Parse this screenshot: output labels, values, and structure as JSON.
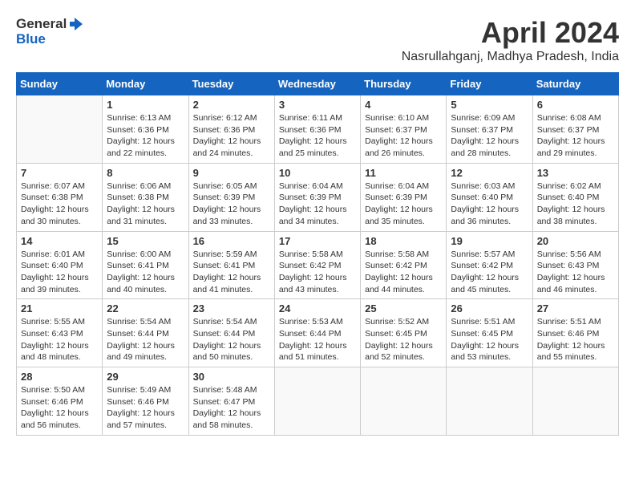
{
  "header": {
    "logo_line1": "General",
    "logo_line2": "Blue",
    "title": "April 2024",
    "subtitle": "Nasrullahganj, Madhya Pradesh, India"
  },
  "columns": [
    "Sunday",
    "Monday",
    "Tuesday",
    "Wednesday",
    "Thursday",
    "Friday",
    "Saturday"
  ],
  "weeks": [
    [
      {
        "day": "",
        "info": ""
      },
      {
        "day": "1",
        "info": "Sunrise: 6:13 AM\nSunset: 6:36 PM\nDaylight: 12 hours\nand 22 minutes."
      },
      {
        "day": "2",
        "info": "Sunrise: 6:12 AM\nSunset: 6:36 PM\nDaylight: 12 hours\nand 24 minutes."
      },
      {
        "day": "3",
        "info": "Sunrise: 6:11 AM\nSunset: 6:36 PM\nDaylight: 12 hours\nand 25 minutes."
      },
      {
        "day": "4",
        "info": "Sunrise: 6:10 AM\nSunset: 6:37 PM\nDaylight: 12 hours\nand 26 minutes."
      },
      {
        "day": "5",
        "info": "Sunrise: 6:09 AM\nSunset: 6:37 PM\nDaylight: 12 hours\nand 28 minutes."
      },
      {
        "day": "6",
        "info": "Sunrise: 6:08 AM\nSunset: 6:37 PM\nDaylight: 12 hours\nand 29 minutes."
      }
    ],
    [
      {
        "day": "7",
        "info": "Sunrise: 6:07 AM\nSunset: 6:38 PM\nDaylight: 12 hours\nand 30 minutes."
      },
      {
        "day": "8",
        "info": "Sunrise: 6:06 AM\nSunset: 6:38 PM\nDaylight: 12 hours\nand 31 minutes."
      },
      {
        "day": "9",
        "info": "Sunrise: 6:05 AM\nSunset: 6:39 PM\nDaylight: 12 hours\nand 33 minutes."
      },
      {
        "day": "10",
        "info": "Sunrise: 6:04 AM\nSunset: 6:39 PM\nDaylight: 12 hours\nand 34 minutes."
      },
      {
        "day": "11",
        "info": "Sunrise: 6:04 AM\nSunset: 6:39 PM\nDaylight: 12 hours\nand 35 minutes."
      },
      {
        "day": "12",
        "info": "Sunrise: 6:03 AM\nSunset: 6:40 PM\nDaylight: 12 hours\nand 36 minutes."
      },
      {
        "day": "13",
        "info": "Sunrise: 6:02 AM\nSunset: 6:40 PM\nDaylight: 12 hours\nand 38 minutes."
      }
    ],
    [
      {
        "day": "14",
        "info": "Sunrise: 6:01 AM\nSunset: 6:40 PM\nDaylight: 12 hours\nand 39 minutes."
      },
      {
        "day": "15",
        "info": "Sunrise: 6:00 AM\nSunset: 6:41 PM\nDaylight: 12 hours\nand 40 minutes."
      },
      {
        "day": "16",
        "info": "Sunrise: 5:59 AM\nSunset: 6:41 PM\nDaylight: 12 hours\nand 41 minutes."
      },
      {
        "day": "17",
        "info": "Sunrise: 5:58 AM\nSunset: 6:42 PM\nDaylight: 12 hours\nand 43 minutes."
      },
      {
        "day": "18",
        "info": "Sunrise: 5:58 AM\nSunset: 6:42 PM\nDaylight: 12 hours\nand 44 minutes."
      },
      {
        "day": "19",
        "info": "Sunrise: 5:57 AM\nSunset: 6:42 PM\nDaylight: 12 hours\nand 45 minutes."
      },
      {
        "day": "20",
        "info": "Sunrise: 5:56 AM\nSunset: 6:43 PM\nDaylight: 12 hours\nand 46 minutes."
      }
    ],
    [
      {
        "day": "21",
        "info": "Sunrise: 5:55 AM\nSunset: 6:43 PM\nDaylight: 12 hours\nand 48 minutes."
      },
      {
        "day": "22",
        "info": "Sunrise: 5:54 AM\nSunset: 6:44 PM\nDaylight: 12 hours\nand 49 minutes."
      },
      {
        "day": "23",
        "info": "Sunrise: 5:54 AM\nSunset: 6:44 PM\nDaylight: 12 hours\nand 50 minutes."
      },
      {
        "day": "24",
        "info": "Sunrise: 5:53 AM\nSunset: 6:44 PM\nDaylight: 12 hours\nand 51 minutes."
      },
      {
        "day": "25",
        "info": "Sunrise: 5:52 AM\nSunset: 6:45 PM\nDaylight: 12 hours\nand 52 minutes."
      },
      {
        "day": "26",
        "info": "Sunrise: 5:51 AM\nSunset: 6:45 PM\nDaylight: 12 hours\nand 53 minutes."
      },
      {
        "day": "27",
        "info": "Sunrise: 5:51 AM\nSunset: 6:46 PM\nDaylight: 12 hours\nand 55 minutes."
      }
    ],
    [
      {
        "day": "28",
        "info": "Sunrise: 5:50 AM\nSunset: 6:46 PM\nDaylight: 12 hours\nand 56 minutes."
      },
      {
        "day": "29",
        "info": "Sunrise: 5:49 AM\nSunset: 6:46 PM\nDaylight: 12 hours\nand 57 minutes."
      },
      {
        "day": "30",
        "info": "Sunrise: 5:48 AM\nSunset: 6:47 PM\nDaylight: 12 hours\nand 58 minutes."
      },
      {
        "day": "",
        "info": ""
      },
      {
        "day": "",
        "info": ""
      },
      {
        "day": "",
        "info": ""
      },
      {
        "day": "",
        "info": ""
      }
    ]
  ]
}
